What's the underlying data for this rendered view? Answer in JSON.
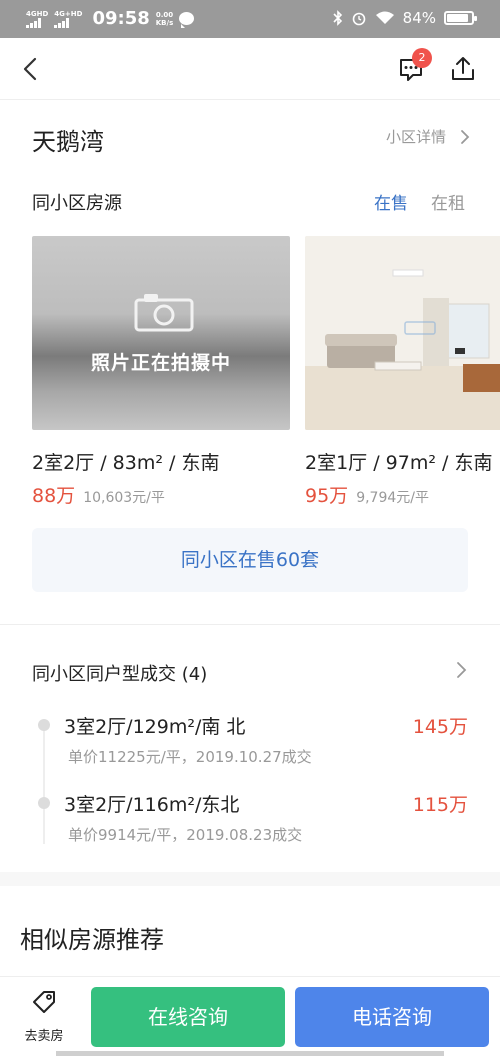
{
  "status_bar": {
    "network1": "4GHD",
    "network2": "4G+HD",
    "time": "09:58",
    "speed_value": "0.00",
    "speed_unit": "KB/s",
    "battery": "84%"
  },
  "nav": {
    "message_badge": "2"
  },
  "community": {
    "name": "天鹅湾",
    "detail_link": "小区详情"
  },
  "same_community": {
    "title": "同小区房源",
    "tab_sale": "在售",
    "tab_rent": "在租",
    "listings": [
      {
        "title": "2室2厅 / 83m² / 东南",
        "price": "88万",
        "unit_price": "10,603元/平",
        "photo_note": "照片正在拍摄中"
      },
      {
        "title": "2室1厅 / 97m² / 东南",
        "price": "95万",
        "unit_price": "9,794元/平",
        "photo_note": ""
      }
    ],
    "more_button": "同小区在售60套"
  },
  "deals": {
    "title": "同小区同户型成交 (4)",
    "items": [
      {
        "layout": "3室2厅/129m²/南 北",
        "price": "145万",
        "detail": "单价11225元/平，2019.10.27成交"
      },
      {
        "layout": "3室2厅/116m²/东北",
        "price": "115万",
        "detail": "单价9914元/平，2019.08.23成交"
      }
    ]
  },
  "similar": {
    "title": "相似房源推荐"
  },
  "bottom_bar": {
    "sell_label": "去卖房",
    "online_consult": "在线咨询",
    "phone_consult": "电话咨询"
  },
  "colors": {
    "accent_blue": "#3a73c6",
    "price_red": "#e4523e",
    "online_green": "#35c07f",
    "phone_blue": "#4e85ea",
    "badge_red": "#f0534c"
  }
}
